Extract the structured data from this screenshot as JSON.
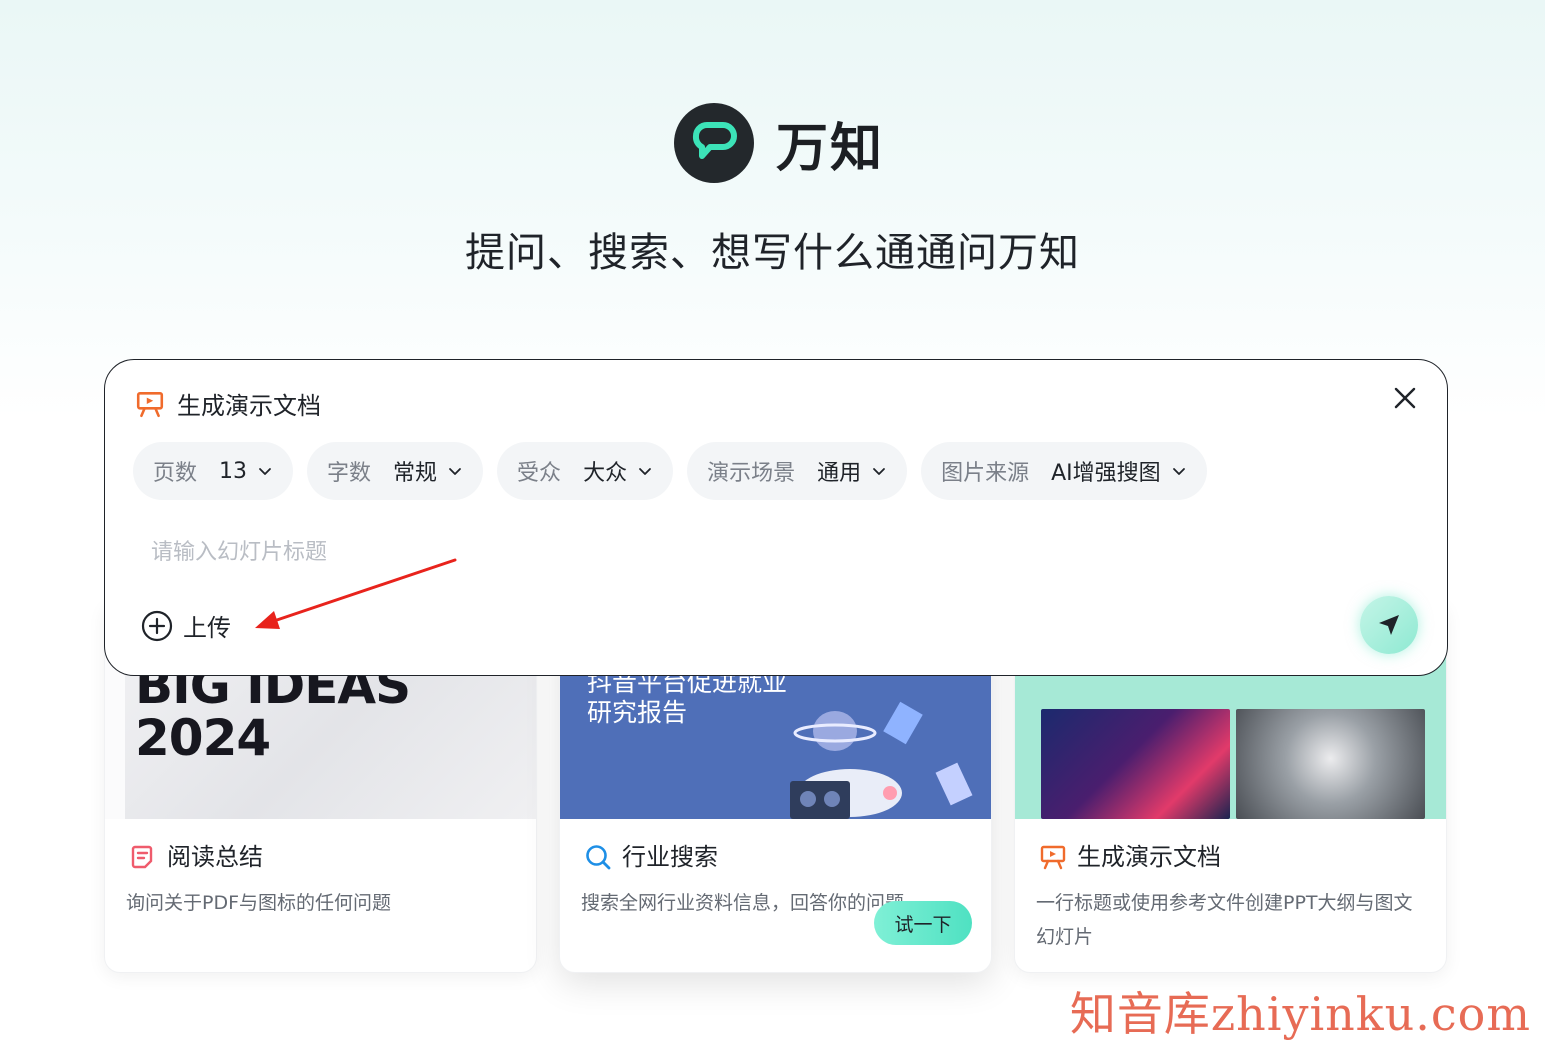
{
  "brand": {
    "name": "万知",
    "tagline": "提问、搜索、想写什么通通问万知"
  },
  "panel": {
    "title": "生成演示文档",
    "options": [
      {
        "label": "页数",
        "value": "13"
      },
      {
        "label": "字数",
        "value": "常规"
      },
      {
        "label": "受众",
        "value": "大众"
      },
      {
        "label": "演示场景",
        "value": "通用"
      },
      {
        "label": "图片来源",
        "value": "AI增强搜图"
      }
    ],
    "input_placeholder": "请输入幻灯片标题",
    "upload_label": "上传"
  },
  "cards": [
    {
      "title": "阅读总结",
      "description": "询问关于PDF与图标的任何问题",
      "image_text": [
        "BIG IDEAS",
        "2024"
      ]
    },
    {
      "title": "行业搜索",
      "description": "搜索全网行业资料信息，回答你的问题",
      "image_text": [
        "抖音平台促进就业",
        "研究报告"
      ],
      "try_label": "试一下"
    },
    {
      "title": "生成演示文档",
      "description": "一行标题或使用参考文件创建PPT大纲与图文幻灯片"
    }
  ],
  "watermark": "知音库zhiyinku.com",
  "colors": {
    "accent": "#4fe1c2",
    "ppt_icon": "#f06b2c",
    "search_icon": "#1e8fe6",
    "read_icon": "#ef5b6c",
    "arrow": "#e8231c"
  }
}
